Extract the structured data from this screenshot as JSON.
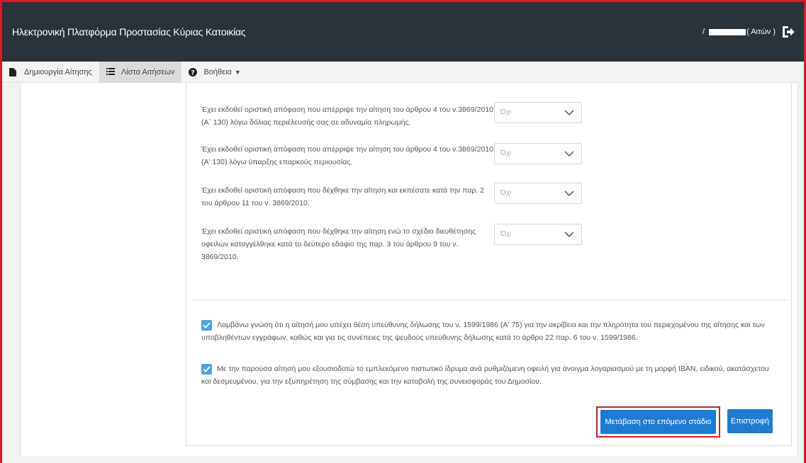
{
  "header": {
    "app_title": "Ηλεκτρονική Πλατφόρμα Προστασίας Κύριας Κατοικίας",
    "user_prefix": "/",
    "user_suffix": "( Αιτών )"
  },
  "menu": {
    "items": [
      {
        "label": "Δημιουργία Αίτησης",
        "icon": "file-icon"
      },
      {
        "label": "Λίστα Αιτήσεων",
        "icon": "list-icon"
      },
      {
        "label": "Βοήθεια",
        "icon": "question-circle-icon"
      }
    ]
  },
  "questions": [
    {
      "text": "Έχει εκδοθεί οριστική απόφαση που απέρριψε την αίτηση του άρθρου 4 του ν.3869/2010 (Α΄ 130) λόγω δόλιας περιέλευσής σας σε αδυναμία πληρωμής.",
      "value": "Όχι"
    },
    {
      "text": "Έχει εκδοθεί οριστική απόφαση που απέρριψε την αίτηση του άρθρου 4 του ν.3869/2010 (Α' 130) λόγω ύπαρξης επαρκούς περιουσίας.",
      "value": "Όχι"
    },
    {
      "text": "Έχει εκδοθεί οριστική απόφαση που δέχθηκε την αίτηση και εκπέσατε κατά την παρ. 2 του άρθρου 11 του ν. 3869/2010.",
      "value": "Όχι"
    },
    {
      "text": "Έχει εκδοθεί οριστική απόφαση που δέχθηκε την αίτηση ενώ το σχέδιο διευθέτησης οφειλών καταγγέλθηκε κατά το δεύτερο εδάφιο της παρ. 3 του άρθρου 9 του ν. 3869/2010.",
      "value": "Όχι"
    }
  ],
  "declarations": [
    {
      "text": "Λαμβάνω γνώση ότι η αίτησή μου υπέχει θέση υπεύθυνης δήλωσης του ν. 1599/1986 (Α' 75) για την ακρίβεια και την πληρότητα του περιεχομένου της αίτησης και των υποβληθέντων εγγράφων, καθώς και για τις συνέπειες της ψευδούς υπεύθυνης δήλωσης κατά το άρθρο 22 παρ. 6 του ν. 1599/1986.",
      "checked": true
    },
    {
      "text": "Με την παρούσα αίτησή μου εξουσιοδοτώ το εμπλεκόμενο πιστωτικό ίδρυμα ανά ρυθμιζόμενη οφειλή για άνοιγμα λογαριασμού με τη μορφή IBAN, ειδικού, ακατάσχετου και δεσμευμένου, για την εξυπηρέτηση της σύμβασης και την καταβολή της συνεισφοράς του Δημοσίου.",
      "checked": true
    }
  ],
  "buttons": {
    "next": "Μετάβαση στο επόμενο στάδιο",
    "back": "Επιστροφή"
  },
  "colors": {
    "header_bg": "#2a323a",
    "primary": "#1f7ad0",
    "checkbox": "#4fa3e0",
    "highlight": "#c8222b"
  }
}
